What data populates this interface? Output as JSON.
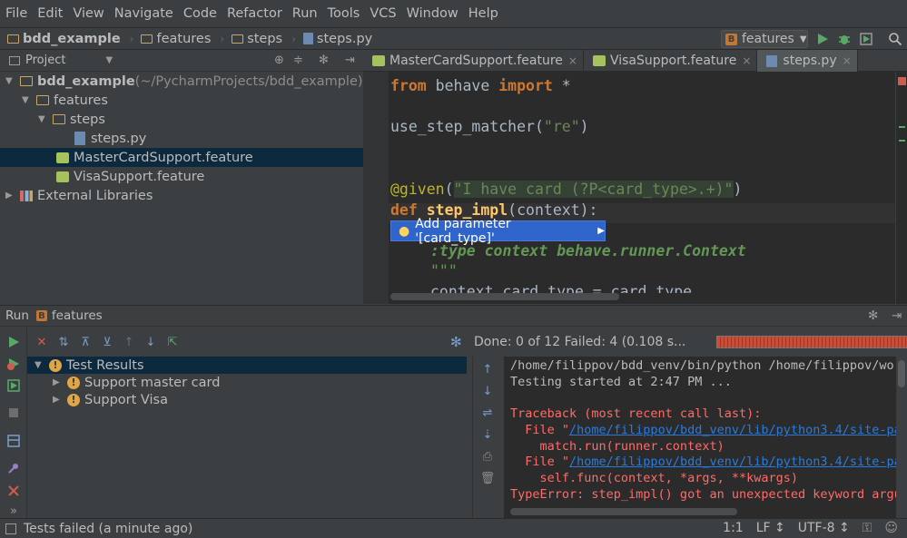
{
  "menu": [
    "File",
    "Edit",
    "View",
    "Navigate",
    "Code",
    "Refactor",
    "Run",
    "Tools",
    "VCS",
    "Window",
    "Help"
  ],
  "breadcrumbs": [
    "bdd_example",
    "features",
    "steps",
    "steps.py"
  ],
  "run_config": {
    "label": "features",
    "badge": "B"
  },
  "project": {
    "header": "Project",
    "tree": [
      {
        "label": "bdd_example",
        "suffix": " (~/PycharmProjects/bdd_example)"
      },
      {
        "label": "features"
      },
      {
        "label": "steps"
      },
      {
        "label": "steps.py"
      },
      {
        "label": "MasterCardSupport.feature"
      },
      {
        "label": "VisaSupport.feature"
      },
      {
        "label": "External Libraries"
      }
    ]
  },
  "editor": {
    "tabs": [
      "MasterCardSupport.feature",
      "VisaSupport.feature",
      "steps.py"
    ],
    "lines": {
      "l1_kw1": "from",
      "l1_mod": " behave ",
      "l1_kw2": "import",
      "l1_rest": " *",
      "l2_fn": "use_step_matcher(",
      "l2_str": "\"re\"",
      "l2_end": ")",
      "l3_dec": "@given",
      "l3_open": "(",
      "l3_str": "\"I have card (?P<card_type>.+)\"",
      "l3_close": ")",
      "l4_kw": "def",
      "l4_fn": " step_impl",
      "l4_rest": "(context):",
      "l5_doc": ":type context behave.runner.Context",
      "l6_doc": "\"\"\"",
      "l7": "context.card_type = card_type"
    },
    "intention": "Add parameter '[card_type]'"
  },
  "run": {
    "header_label": "Run",
    "config": "features",
    "status": "Done: 0 of 12  Failed: 4  (0.108 s...",
    "progress_failed_fraction": 1.0,
    "results": [
      {
        "label": "Test Results"
      },
      {
        "label": "Support master card"
      },
      {
        "label": "Support Visa"
      }
    ],
    "console": {
      "line1": "/home/filippov/bdd_venv/bin/python /home/filippov/work",
      "line2": "Testing started at 2:47 PM ...",
      "line3": "Traceback (most recent call last):",
      "line4_pre": "  File \"",
      "line4_link": "/home/filippov/bdd_venv/lib/python3.4/site-pac",
      "line5": "    match.run(runner.context)",
      "line6_pre": "  File \"",
      "line6_link": "/home/filippov/bdd_venv/lib/python3.4/site-pac",
      "line7": "    self.func(context, *args, **kwargs)",
      "line8": "TypeError: step_impl() got an unexpected keyword argum"
    }
  },
  "statusbar": {
    "message": "Tests failed (a minute ago)",
    "position": "1:1",
    "line_sep": "LF ↕",
    "encoding": "UTF-8 ↕"
  },
  "colors": {
    "accent": "#2f65ca",
    "error": "#ff6b68",
    "link": "#287bde",
    "keyword": "#cc7832",
    "string": "#6a8759"
  }
}
